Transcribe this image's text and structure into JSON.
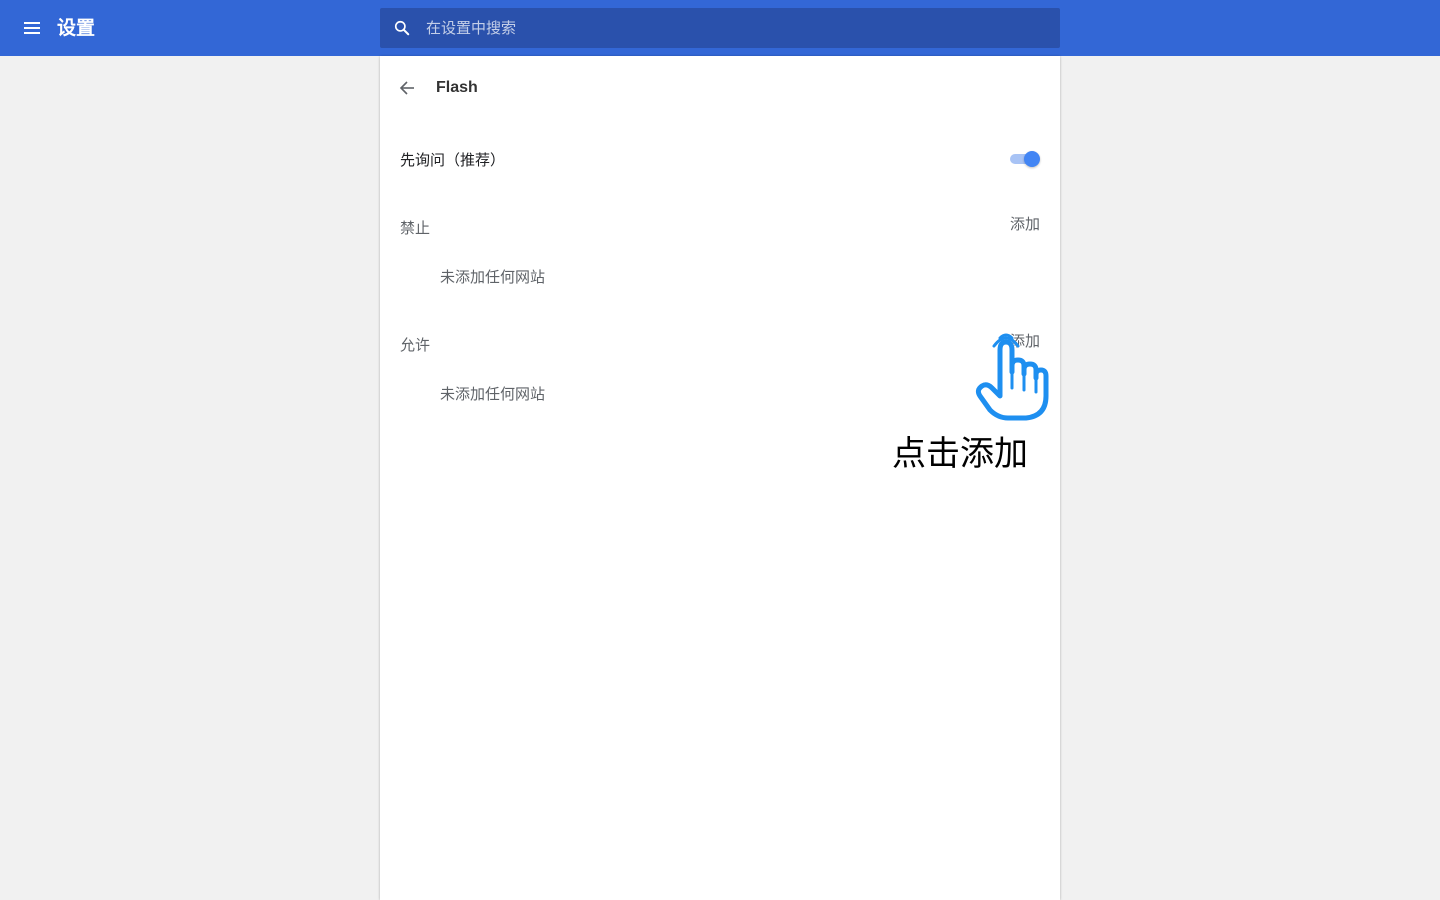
{
  "header": {
    "title": "设置",
    "search_placeholder": "在设置中搜索"
  },
  "page": {
    "title": "Flash"
  },
  "ask_first": {
    "label": "先询问（推荐）",
    "enabled": true
  },
  "blocked": {
    "heading": "禁止",
    "add_label": "添加",
    "empty_text": "未添加任何网站"
  },
  "allowed": {
    "heading": "允许",
    "add_label": "添加",
    "empty_text": "未添加任何网站"
  },
  "annotation": {
    "text": "点击添加",
    "icon": "pointing-hand-icon"
  },
  "colors": {
    "header_bg": "#3367d6",
    "search_bg": "#2a51ac",
    "toggle_on": "#4285f4",
    "hand_icon": "#1e8ff0"
  }
}
